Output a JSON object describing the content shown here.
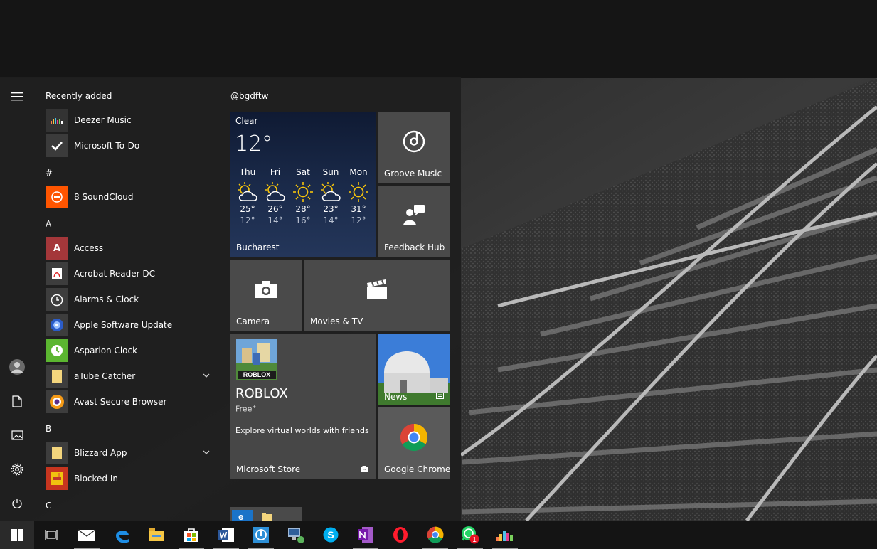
{
  "start_menu": {
    "section_recent": "Recently added",
    "recent": [
      {
        "name": "Deezer Music",
        "icon": "deezer-icon"
      },
      {
        "name": "Microsoft To-Do",
        "icon": "todo-icon"
      }
    ],
    "section_hash": "#",
    "hash_apps": [
      {
        "name": "8 SoundCloud",
        "icon": "soundcloud-icon"
      }
    ],
    "section_a": "A",
    "a_apps": [
      {
        "name": "Access",
        "icon": "access-icon"
      },
      {
        "name": "Acrobat Reader DC",
        "icon": "acrobat-icon"
      },
      {
        "name": "Alarms & Clock",
        "icon": "alarm-clock-icon"
      },
      {
        "name": "Apple Software Update",
        "icon": "apple-update-icon"
      },
      {
        "name": "Asparion Clock",
        "icon": "asparion-clock-icon"
      },
      {
        "name": "aTube Catcher",
        "icon": "folder-icon"
      },
      {
        "name": "Avast Secure Browser",
        "icon": "avast-icon"
      }
    ],
    "section_b": "B",
    "b_apps": [
      {
        "name": "Blizzard App",
        "icon": "folder-icon"
      },
      {
        "name": "Blocked In",
        "icon": "blocked-in-icon"
      }
    ],
    "section_c": "C",
    "access_letter": "A"
  },
  "tiles": {
    "group_title": "@bgdftw",
    "weather": {
      "condition": "Clear",
      "temp": "12°",
      "city": "Bucharest",
      "forecast": [
        {
          "day": "Thu",
          "hi": "25°",
          "lo": "12°",
          "icon": "partly-sunny-icon"
        },
        {
          "day": "Fri",
          "hi": "26°",
          "lo": "14°",
          "icon": "partly-sunny-icon"
        },
        {
          "day": "Sat",
          "hi": "28°",
          "lo": "16°",
          "icon": "sunny-icon"
        },
        {
          "day": "Sun",
          "hi": "23°",
          "lo": "14°",
          "icon": "partly-sunny-icon"
        },
        {
          "day": "Mon",
          "hi": "31°",
          "lo": "12°",
          "icon": "sunny-icon"
        }
      ]
    },
    "groove": "Groove Music",
    "feedback": "Feedback Hub",
    "camera": "Camera",
    "movies": "Movies & TV",
    "store": {
      "app": "ROBLOX",
      "price": "Free",
      "price_mark": "+",
      "desc": "Explore virtual worlds with friends",
      "label": "Microsoft Store",
      "logo_text": "ROBLOX"
    },
    "news": "News",
    "chrome": "Google Chrome"
  },
  "taskbar": {
    "items": [
      "windows-logo-icon",
      "task-view-icon",
      "mail-icon",
      "edge-icon",
      "file-explorer-icon",
      "store-icon",
      "word-icon",
      "app-icon",
      "network-icon",
      "skype-icon",
      "onenote-icon",
      "opera-icon",
      "chrome-icon",
      "whatsapp-icon",
      "deezer-icon"
    ],
    "whatsapp_badge": "1"
  }
}
